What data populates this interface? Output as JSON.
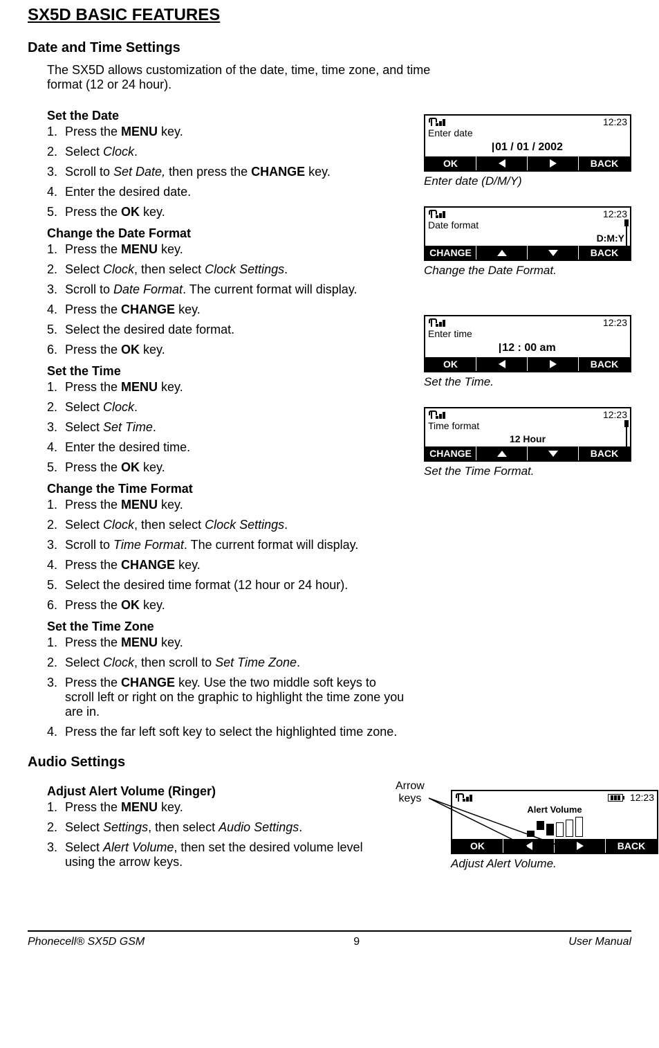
{
  "page": {
    "title": "SX5D BASIC FEATURES",
    "footer_left": "Phonecell® SX5D GSM",
    "footer_center": "9",
    "footer_right": "User Manual"
  },
  "section_datetime": {
    "heading": "Date and Time Settings",
    "intro": "The SX5D allows customization of the date, time, time zone, and time format (12 or 24 hour)."
  },
  "set_date": {
    "heading": "Set the Date",
    "steps": {
      "s1a": "Press the ",
      "s1b": "MENU",
      "s1c": " key.",
      "s2a": "Select ",
      "s2b": "Clock",
      "s2c": ".",
      "s3a": "Scroll to ",
      "s3b": "Set Date,",
      "s3c": " then press the ",
      "s3d": "CHANGE",
      "s3e": " key.",
      "s4": "Enter the desired date.",
      "s5a": "Press the ",
      "s5b": "OK",
      "s5c": " key."
    }
  },
  "date_format": {
    "heading": "Change the Date Format",
    "steps": {
      "s1a": "Press the ",
      "s1b": "MENU",
      "s1c": " key.",
      "s2a": "Select ",
      "s2b": "Clock",
      "s2c": ", then select ",
      "s2d": "Clock Settings",
      "s2e": ".",
      "s3a": "Scroll to ",
      "s3b": "Date Format",
      "s3c": ". The current format will display.",
      "s4a": "Press the ",
      "s4b": "CHANGE",
      "s4c": " key.",
      "s5": "Select the desired date format.",
      "s6a": "Press the ",
      "s6b": "OK",
      "s6c": " key."
    }
  },
  "set_time": {
    "heading": "Set the Time",
    "steps": {
      "s1a": "Press the ",
      "s1b": "MENU",
      "s1c": " key.",
      "s2a": "Select ",
      "s2b": "Clock",
      "s2c": ".",
      "s3a": "Select ",
      "s3b": "Set Time",
      "s3c": ".",
      "s4": "Enter the desired time.",
      "s5a": "Press the ",
      "s5b": "OK",
      "s5c": " key."
    }
  },
  "time_format": {
    "heading": "Change the Time Format",
    "steps": {
      "s1a": "Press the ",
      "s1b": "MENU",
      "s1c": " key.",
      "s2a": "Select ",
      "s2b": "Clock",
      "s2c": ", then select ",
      "s2d": "Clock Settings",
      "s2e": ".",
      "s3a": "Scroll to ",
      "s3b": "Time Format",
      "s3c": ". The current format will display.",
      "s4a": "Press the ",
      "s4b": "CHANGE",
      "s4c": " key.",
      "s5": "Select the desired time format (12 hour or 24 hour).",
      "s6a": "Press the ",
      "s6b": "OK",
      "s6c": " key."
    }
  },
  "time_zone": {
    "heading": "Set the Time Zone",
    "steps": {
      "s1a": "Press the ",
      "s1b": "MENU",
      "s1c": " key.",
      "s2a": "Select ",
      "s2b": "Clock",
      "s2c": ", then scroll to ",
      "s2d": "Set Time Zone",
      "s2e": ".",
      "s3a": "Press the ",
      "s3b": "CHANGE",
      "s3c": " key. Use the two middle soft keys to scroll left or right on the graphic to highlight the time zone you are in.",
      "s4": "Press the far left soft key to select the highlighted time zone."
    }
  },
  "section_audio": {
    "heading": "Audio Settings"
  },
  "alert_volume": {
    "heading": "Adjust Alert Volume (Ringer)",
    "steps": {
      "s1a": "Press the ",
      "s1b": "MENU",
      "s1c": " key.",
      "s2a": "Select ",
      "s2b": "Settings",
      "s2c": ", then select ",
      "s2d": "Audio Settings",
      "s2e": ".",
      "s3a": "Select ",
      "s3b": "Alert Volume",
      "s3c": ", then set the desired volume level using the arrow keys."
    },
    "anno_label": "Arrow\nkeys"
  },
  "fig_date": {
    "clock": "12:23",
    "label": "Enter date",
    "value": "01    /    01    /   2002",
    "soft_left": "OK",
    "soft_right": "BACK",
    "caption": "Enter date (D/M/Y)"
  },
  "fig_dateformat": {
    "clock": "12:23",
    "label": "Date format",
    "value": "D:M:Y",
    "soft_left": "CHANGE",
    "soft_right": "BACK",
    "caption": "Change the Date Format."
  },
  "fig_time": {
    "clock": "12:23",
    "label": "Enter time",
    "value": "12 : 00   am",
    "soft_left": "OK",
    "soft_right": "BACK",
    "caption": "Set the Time."
  },
  "fig_timeformat": {
    "clock": "12:23",
    "label": "Time format",
    "value": "12 Hour",
    "soft_left": "CHANGE",
    "soft_right": "BACK",
    "caption": "Set the Time Format."
  },
  "fig_alert": {
    "clock": "12:23",
    "title": "Alert  Volume",
    "soft_left": "OK",
    "soft_right": "BACK",
    "caption": "Adjust Alert Volume."
  }
}
